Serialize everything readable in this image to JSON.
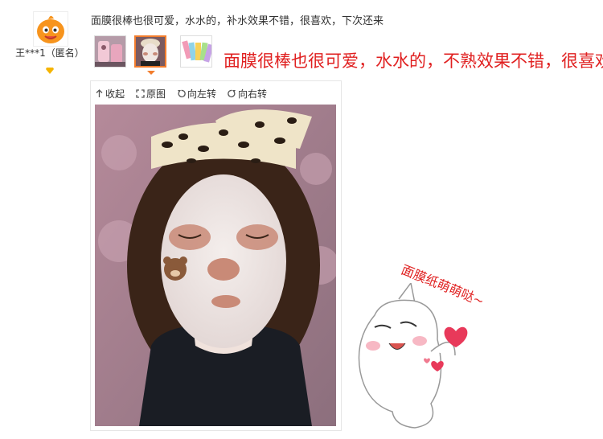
{
  "user": {
    "name": "王***1（匿名）"
  },
  "review": {
    "text": "面膜很棒也很可爱，水水的，补水效果不错，很喜欢，下次还来"
  },
  "overlay": {
    "caption": "面膜很棒也很可爱，水水的，不熟效果不错，很喜欢",
    "sticker": "面膜纸萌萌哒~"
  },
  "toolbar": {
    "collapse_label": "收起",
    "original_label": "原图",
    "rotate_left_label": "向左转",
    "rotate_right_label": "向右转"
  },
  "colors": {
    "accent": "#f27d2d",
    "overlay_text": "#e02020"
  }
}
